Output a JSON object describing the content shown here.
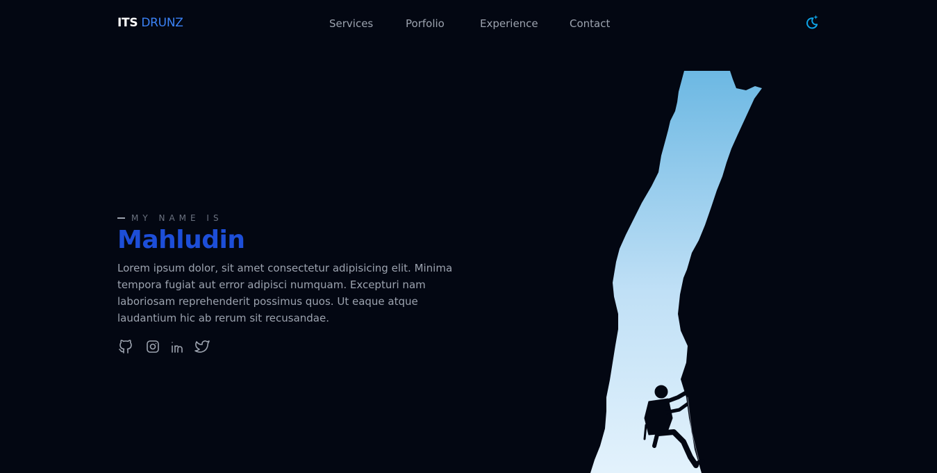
{
  "brand": {
    "bold": "ITS",
    "accent": "DRUNZ"
  },
  "nav": {
    "items": [
      {
        "label": "Services"
      },
      {
        "label": "Porfolio"
      },
      {
        "label": "Experience"
      },
      {
        "label": "Contact"
      }
    ]
  },
  "theme_toggle": {
    "icon": "moon-sparkle-icon"
  },
  "hero": {
    "eyebrow": "MY NAME IS",
    "name": "Mahludin",
    "bio": "Lorem ipsum dolor, sit amet consectetur adipisicing elit. Minima tempora fugiat aut error adipisci numquam. Excepturi nam laboriosam reprehenderit possimus quos. Ut eaque atque laudantium hic ab rerum sit recusandae.",
    "socials": [
      {
        "icon": "github-icon"
      },
      {
        "icon": "instagram-icon"
      },
      {
        "icon": "linkedin-icon"
      },
      {
        "icon": "twitter-icon"
      }
    ],
    "illustration": "rock-climber-silhouette"
  },
  "colors": {
    "background": "#030712",
    "accent": "#1d4ed8",
    "brand_accent": "#3b82f6",
    "muted_text": "#9ca3af",
    "toggle": "#0ea5e9",
    "sky_top": "#6cb8e3",
    "sky_bottom": "#e3f2fc"
  }
}
